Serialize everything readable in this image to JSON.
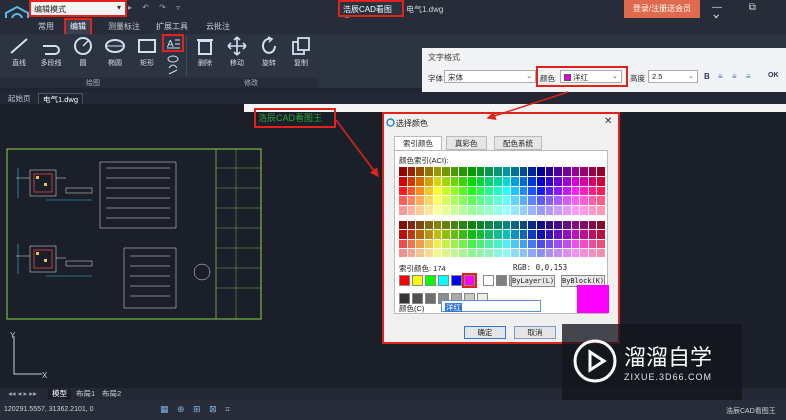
{
  "titlebar": {
    "mode_select": "编辑模式",
    "quick_icons": "▸ ↶ ↷ ▿",
    "app_title": "浩辰CAD看图王",
    "doc_title": "电气1.dwg",
    "login": "登录/注册送会员",
    "window_controls": "— ⧉ ✕"
  },
  "tabs": [
    "常用",
    "编辑",
    "测量标注",
    "扩展工具",
    "云批注"
  ],
  "ribbon": {
    "draw": [
      "直线",
      "多段线",
      "圆",
      "椭圆",
      "矩形"
    ],
    "modify": [
      "删除",
      "移动",
      "旋转",
      "复制"
    ],
    "groups": [
      "绘图",
      "修改"
    ]
  },
  "doc_tabs": [
    "起始页",
    "电气1.dwg"
  ],
  "text_format": {
    "title": "文字格式",
    "font_label": "字体",
    "font_value": "宋体",
    "color_label": "颜色",
    "color_value": "洋红",
    "height_label": "高度",
    "height_value": "2.5",
    "bold": "B",
    "ok": "OK"
  },
  "canvas_text": "浩辰CAD看图王",
  "dialog": {
    "title": "选择颜色",
    "close": "✕",
    "tabs": [
      "索引颜色",
      "真彩色",
      "配色系统"
    ],
    "aci_label": "颜色索引(ACI):",
    "index_label": "索引颜色: 174",
    "rgb_label": "RGB: 0,0,153",
    "bylayer": "ByLayer(L)",
    "byblock": "ByBlock(K)",
    "color_label": "颜色(C)",
    "color_value": "洋红",
    "ok": "确定",
    "cancel": "取消"
  },
  "model_tabs": [
    "模型",
    "布局1",
    "布局2"
  ],
  "status": {
    "coords": "120291.5557, 31362.2101, 0",
    "icons": "▦ ⊕ ⊞ ⊠ ⌗",
    "right": "浩辰CAD看图王"
  },
  "watermark": {
    "title": "溜溜自学",
    "url": "ZIXUE.3D66.COM"
  },
  "colors": {
    "accent_red": "#e0241c",
    "magenta": "#ff00ff",
    "login_btn": "#e06a4e",
    "canvas_text": "#2fa63b"
  }
}
